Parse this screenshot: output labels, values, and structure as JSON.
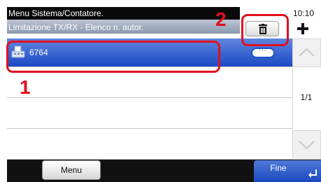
{
  "header": {
    "title": "Menu Sistema/Contatore.",
    "subtitle": "Limitazione TX/RX - Elenco n. autor.",
    "time": "10:10"
  },
  "toolbar": {
    "delete_icon": "trash-icon",
    "add_icon": "plus-icon"
  },
  "list": {
    "rows": [
      {
        "label": "6764",
        "selected": true,
        "icon": "fax-icon",
        "detail_label": "···"
      },
      {
        "label": ""
      },
      {
        "label": ""
      },
      {
        "label": ""
      }
    ]
  },
  "pager": {
    "indicator": "1/1"
  },
  "footer": {
    "menu_label": "Menu",
    "done_label": "Fine"
  },
  "callouts": {
    "one": "1",
    "two": "2"
  },
  "colors": {
    "accent_blue": "#1a49c4",
    "callout_red": "#e0101e",
    "bar_black": "#0a0a0a"
  }
}
